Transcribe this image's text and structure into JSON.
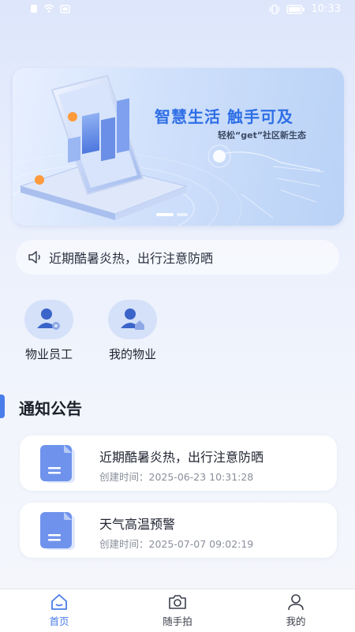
{
  "status_bar": {
    "time": "10:33"
  },
  "banner": {
    "title": "智慧生活 触手可及",
    "subtitle": "轻松“get”社区新生态",
    "pages": 2,
    "active_page": 1
  },
  "notice_bar": {
    "icon": "speaker-icon",
    "text": "近期酷暑炎热，出行注意防晒"
  },
  "quick_actions": [
    {
      "label": "物业员工",
      "icon": "staff-icon"
    },
    {
      "label": "我的物业",
      "icon": "my-property-icon"
    }
  ],
  "section": {
    "title": "通知公告"
  },
  "notices": [
    {
      "title": "近期酷暑炎热，出行注意防晒",
      "time": "创建时间：2025-06-23 10:31:28"
    },
    {
      "title": "天气高温预警",
      "time": "创建时间：2025-07-07 09:02:19"
    }
  ],
  "tabbar": {
    "tabs": [
      {
        "label": "首页",
        "icon": "home-icon",
        "active": true
      },
      {
        "label": "随手拍",
        "icon": "camera-icon",
        "active": false
      },
      {
        "label": "我的",
        "icon": "profile-icon",
        "active": false
      }
    ]
  },
  "colors": {
    "accent": "#4a7de9",
    "banner_title": "#2f6fe6",
    "quick_bg": "#d5e1f9",
    "doc_icon": "#6f93ec"
  }
}
